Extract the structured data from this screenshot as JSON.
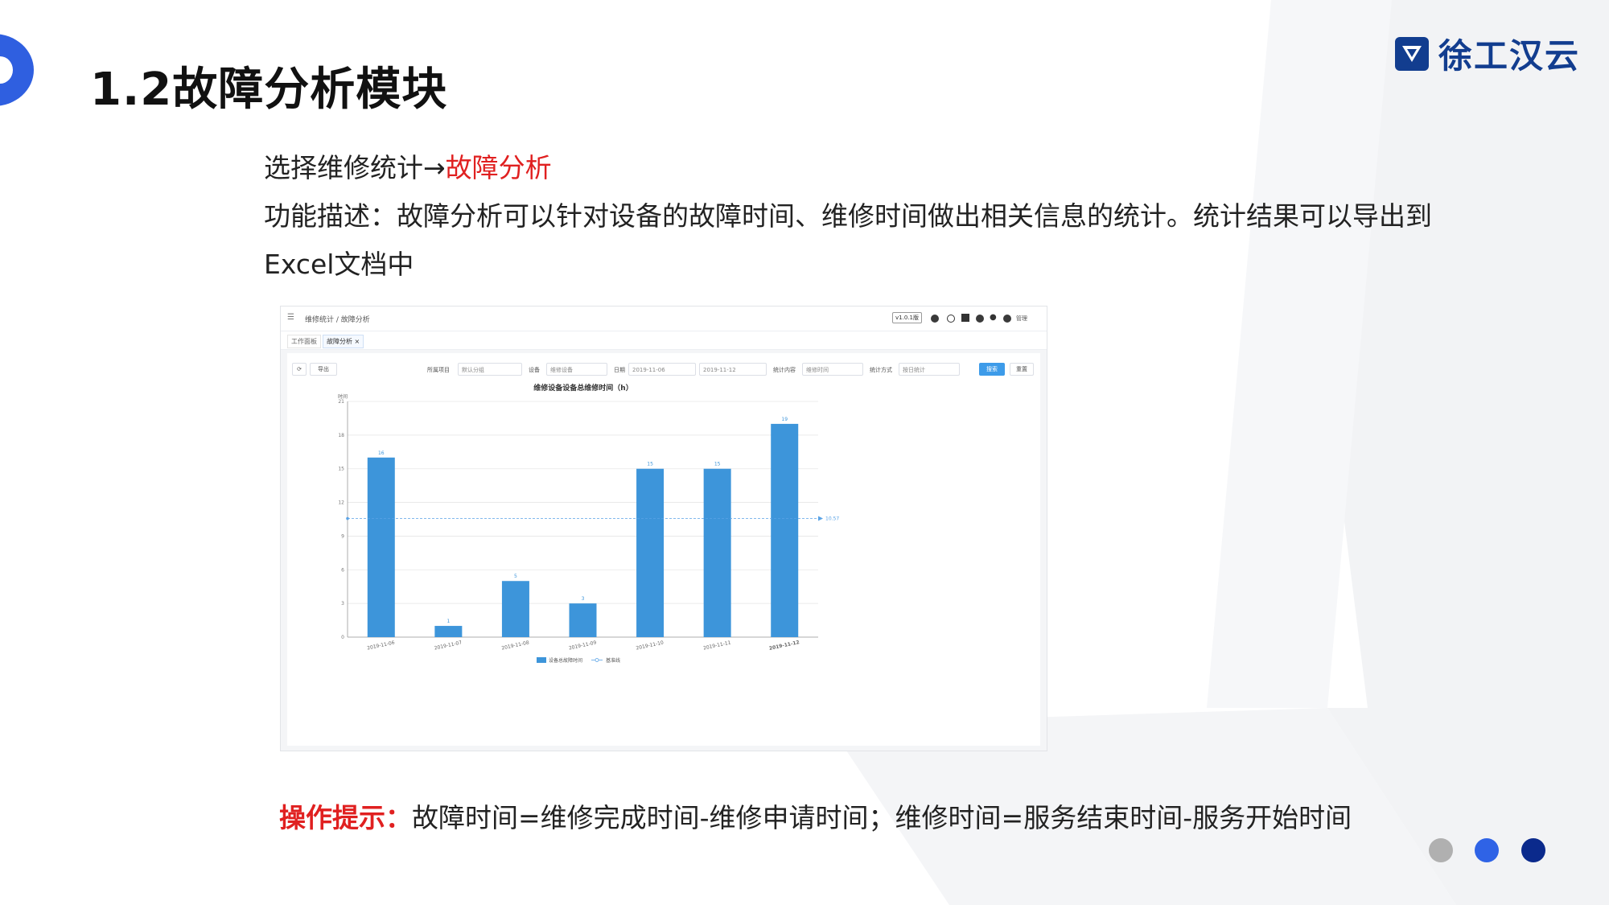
{
  "slide": {
    "title": "1.2故障分析模块",
    "logo_text": "徐工汉云",
    "nav_line_prefix": "选择维修统计→",
    "nav_line_highlight": "故障分析",
    "desc_line1": "功能描述：故障分析可以针对设备的故障时间、维修时间做出相关信息的统计。统计结果可以导出到",
    "desc_line2": "Excel文档中",
    "tip_label": "操作提示：",
    "tip_text": "故障时间=维修完成时间-维修申请时间；维修时间=服务结束时间-服务开始时间",
    "dot_colors": [
      "#b0b0b0",
      "#2f63e6",
      "#0b2a8c"
    ]
  },
  "app": {
    "breadcrumb": "维修统计 / 故障分析",
    "version": "v1.0.1版",
    "user_name": "管理",
    "tabs": [
      "工作面板",
      "故障分析 ×"
    ],
    "toolbar": {
      "export_label": "导出"
    },
    "filters": {
      "project_label": "所属项目",
      "project_value": "默认分组",
      "device_label": "设备",
      "device_value": "维修设备",
      "date_label": "日期",
      "date_start": "2019-11-06",
      "date_end": "2019-11-12",
      "content_label": "统计内容",
      "content_value": "维修时间",
      "method_label": "统计方式",
      "method_value": "按日统计"
    },
    "search_label": "搜索",
    "reset_label": "重置"
  },
  "chart_data": {
    "type": "bar",
    "title": "维修设备设备总维修时间（h）",
    "ylabel": "时间",
    "categories": [
      "2019-11-06",
      "2019-11-07",
      "2019-11-08",
      "2019-11-09",
      "2019-11-10",
      "2019-11-11",
      "2019-11-12"
    ],
    "series": [
      {
        "name": "设备总故障时间",
        "values": [
          16,
          1,
          5,
          3,
          15,
          15,
          19
        ]
      }
    ],
    "baseline": {
      "name": "基准线",
      "value": 10.57,
      "label": "10.57"
    },
    "yticks": [
      0,
      3,
      6,
      9,
      12,
      15,
      18,
      21
    ],
    "ylim": [
      0,
      21
    ],
    "grid": true,
    "legend_position": "bottom",
    "bar_color": "#3d95da"
  }
}
